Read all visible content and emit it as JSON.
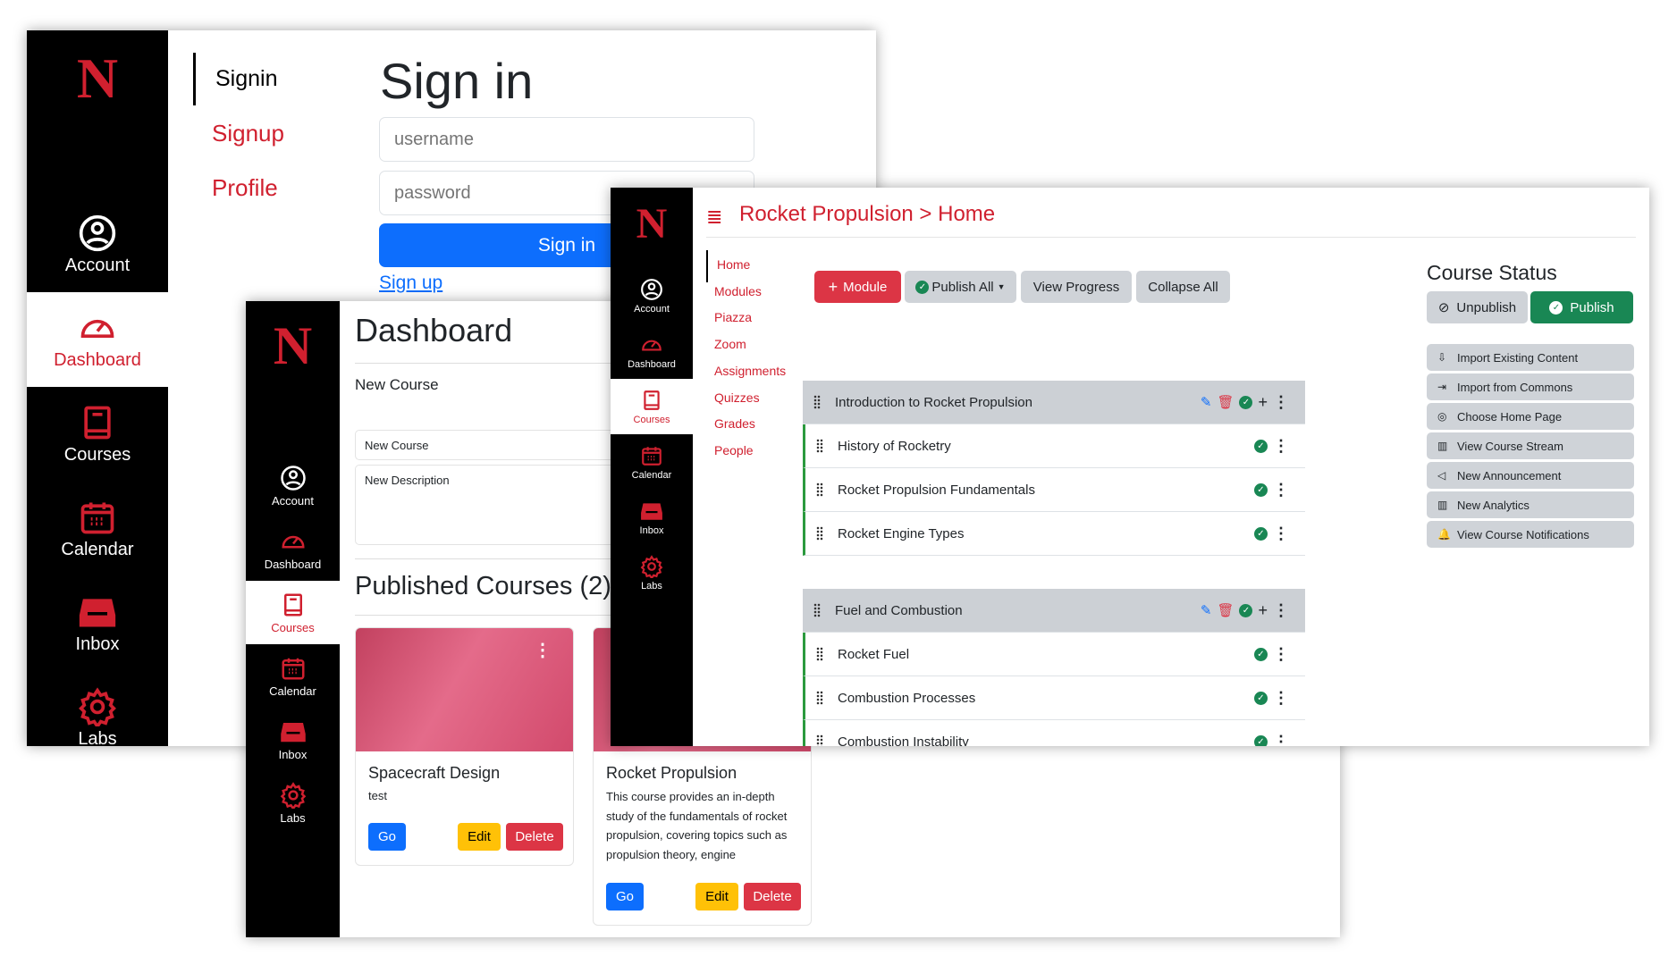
{
  "sidebar_items": [
    "Account",
    "Dashboard",
    "Courses",
    "Calendar",
    "Inbox",
    "Labs"
  ],
  "logo_letter": "N",
  "colors": {
    "brand_red": "#d0202f",
    "primary_blue": "#0d6efd",
    "success_green": "#198754",
    "warning_yellow": "#ffc107",
    "danger_red": "#dc3545",
    "sidebar_black": "#000000"
  },
  "signin": {
    "subnav": [
      "Signin",
      "Signup",
      "Profile"
    ],
    "title": "Sign in",
    "username_placeholder": "username",
    "password_placeholder": "password",
    "signin_button": "Sign in",
    "signup_link": "Sign up"
  },
  "dashboard": {
    "title": "Dashboard",
    "new_course_heading": "New Course",
    "name_value": "New Course",
    "description_value": "New Description",
    "published_heading": "Published Courses (2)",
    "cards": [
      {
        "title": "Spacecraft Design",
        "description": "test",
        "go": "Go",
        "edit": "Edit",
        "delete": "Delete"
      },
      {
        "title": "Rocket Propulsion",
        "description": "This course provides an in-depth study of the fundamentals of rocket propulsion, covering topics such as propulsion theory, engine",
        "go": "Go",
        "edit": "Edit",
        "delete": "Delete"
      }
    ]
  },
  "course": {
    "breadcrumb": "Rocket Propulsion > Home",
    "nav": [
      "Home",
      "Modules",
      "Piazza",
      "Zoom",
      "Assignments",
      "Quizzes",
      "Grades",
      "People"
    ],
    "toolbar": {
      "module": "Module",
      "publish_all": "Publish All",
      "view_progress": "View Progress",
      "collapse_all": "Collapse All"
    },
    "modules": [
      {
        "title": "Introduction to Rocket Propulsion",
        "lessons": [
          "History of Rocketry",
          "Rocket Propulsion Fundamentals",
          "Rocket Engine Types"
        ]
      },
      {
        "title": "Fuel and Combustion",
        "lessons": [
          "Rocket Fuel",
          "Combustion Processes",
          "Combustion Instability"
        ]
      }
    ],
    "status": {
      "title": "Course Status",
      "unpublish": "Unpublish",
      "publish": "Publish",
      "actions": [
        {
          "label": "Import Existing Content",
          "icon": "import-icon"
        },
        {
          "label": "Import from Commons",
          "icon": "import-commons-icon"
        },
        {
          "label": "Choose Home Page",
          "icon": "target-icon"
        },
        {
          "label": "View Course Stream",
          "icon": "bar-chart-icon"
        },
        {
          "label": "New Announcement",
          "icon": "megaphone-icon"
        },
        {
          "label": "New Analytics",
          "icon": "bar-chart-icon"
        },
        {
          "label": "View Course Notifications",
          "icon": "bell-icon"
        }
      ]
    }
  }
}
